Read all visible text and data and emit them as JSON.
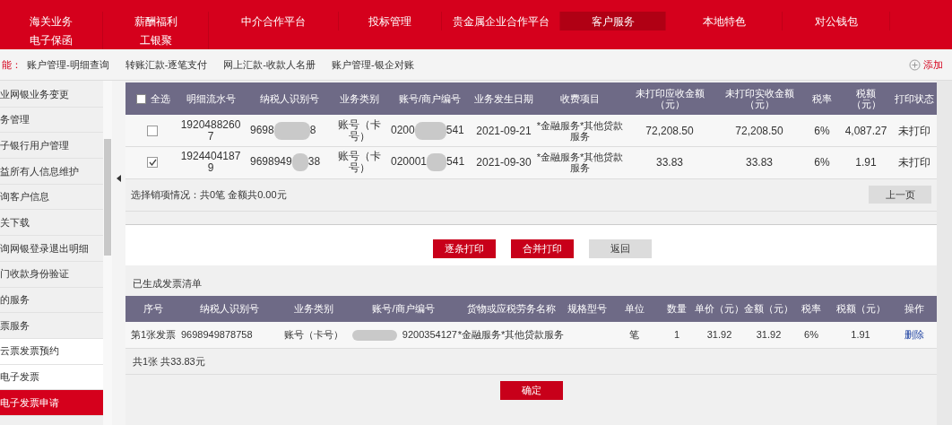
{
  "top_menu": [
    {
      "label": "海关业务",
      "selected": false
    },
    {
      "label": "薪酬福利",
      "selected": false
    },
    {
      "label": "中介合作平台",
      "selected": false
    },
    {
      "label": "投标管理",
      "selected": false
    },
    {
      "label": "贵金属企业合作平台",
      "selected": false
    },
    {
      "label": "客户服务",
      "selected": true
    },
    {
      "label": "本地特色",
      "selected": false
    },
    {
      "label": "对公钱包",
      "selected": false
    },
    {
      "label": "电子保函",
      "selected": false
    },
    {
      "label": "工银聚",
      "selected": false
    }
  ],
  "quick_bar": {
    "label": "能：",
    "links": [
      "账户管理-明细查询",
      "转账汇款-逐笔支付",
      "网上汇款-收款人名册",
      "账户管理-银企对账"
    ],
    "add": "添加"
  },
  "sidebar": {
    "items": [
      {
        "label": "业网银业务变更",
        "selected": false
      },
      {
        "label": "务管理",
        "selected": false
      },
      {
        "label": "子银行用户管理",
        "selected": false
      },
      {
        "label": "益所有人信息维护",
        "selected": false
      },
      {
        "label": "询客户信息",
        "selected": false
      },
      {
        "label": "关下载",
        "selected": false
      },
      {
        "label": "询网银登录退出明细",
        "selected": false
      },
      {
        "label": "门收款身份验证",
        "selected": false
      },
      {
        "label": "的服务",
        "selected": false
      },
      {
        "label": "票服务",
        "selected": false
      },
      {
        "label": "云票发票预约",
        "selected": false
      },
      {
        "label": "电子发票",
        "selected": false
      },
      {
        "label": "电子发票申请",
        "selected": true
      }
    ]
  },
  "items_table": {
    "select_all": {
      "label": "全选",
      "checked": false
    },
    "columns": [
      "明细流水号",
      "纳税人识别号",
      "业务类别",
      "账号/商户编号",
      "业务发生日期",
      "收费项目",
      "未打印应收金额（元）",
      "未打印实收金额（元）",
      "税率",
      "税额（元）",
      "打印状态"
    ],
    "rows": [
      {
        "checked": false,
        "serial": "19204882607",
        "taxpayer_id_start": "9698",
        "taxpayer_id_end": "8",
        "type": "账号（卡号）",
        "account_start": "0200",
        "account_end": "541",
        "date": "2021-09-21",
        "item": "*金融服务*其他贷款服务",
        "receivable": "72,208.50",
        "received": "72,208.50",
        "rate": "6%",
        "tax": "4,087.27",
        "status": "未打印"
      },
      {
        "checked": true,
        "serial": "19244041879",
        "taxpayer_id_start": "9698949",
        "taxpayer_id_end": "38",
        "type": "账号（卡号）",
        "account_start": "020001",
        "account_end": "541",
        "date": "2021-09-30",
        "item": "*金融服务*其他贷款服务",
        "receivable": "33.83",
        "received": "33.83",
        "rate": "6%",
        "tax": "1.91",
        "status": "未打印"
      }
    ],
    "summary": "选择销项情况：共0笔 金额共0.00元",
    "prev_button": "上一页"
  },
  "actions": [
    "逐条打印",
    "合并打印",
    "返回"
  ],
  "invoices": {
    "title": "已生成发票清单",
    "columns": [
      "序号",
      "纳税人识别号",
      "业务类别",
      "账号/商户编号",
      "货物或应税劳务名称",
      "规格型号",
      "单位",
      "数量",
      "单价（元）",
      "金额（元）",
      "税率",
      "税额（元）",
      "操作"
    ],
    "rows": [
      {
        "no": "第1张发票",
        "taxpayer_id": "9698949878758",
        "type": "账号（卡号）",
        "account": "9200354127",
        "goods": "*金融服务*其他贷款服务",
        "unit": "笔",
        "qty": "1",
        "price": "31.92",
        "amount": "31.92",
        "rate": "6%",
        "tax": "1.91",
        "action": "删除"
      }
    ],
    "total": "共1张 共33.83元",
    "confirm": "确定"
  }
}
